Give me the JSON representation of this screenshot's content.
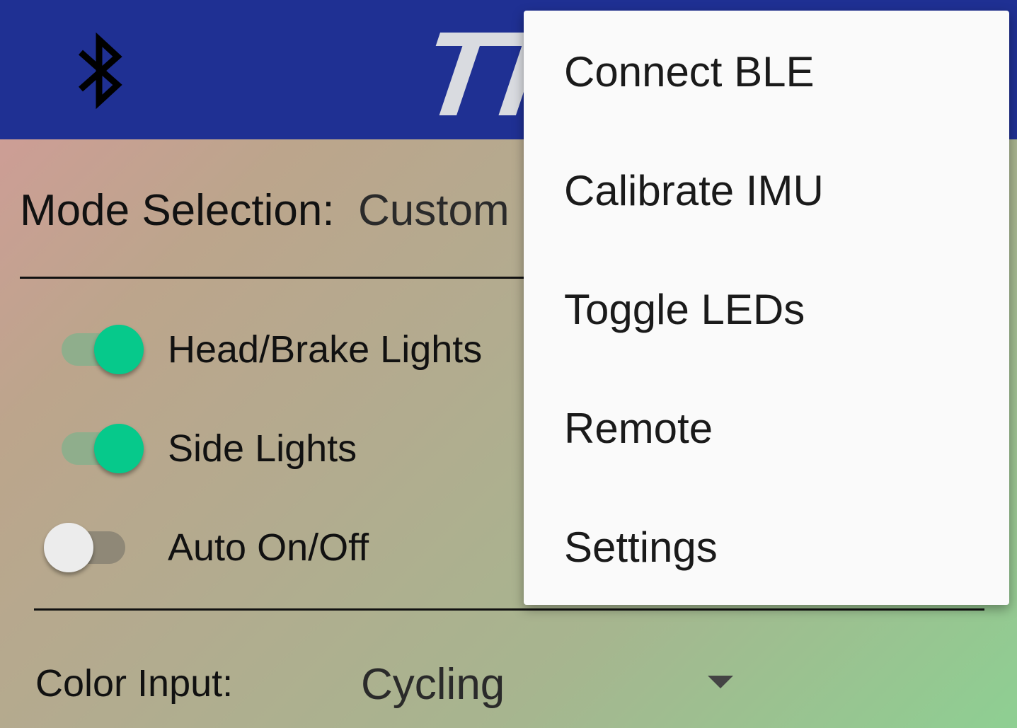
{
  "toolbar": {
    "bluetooth_icon": "bluetooth-icon",
    "logo_text": "TT",
    "background_color": "#1f3093"
  },
  "mode": {
    "label": "Mode Selection:",
    "value": "Custom"
  },
  "switches": [
    {
      "label": "Head/Brake Lights",
      "on": true
    },
    {
      "label": "Side Lights",
      "on": true
    },
    {
      "label": "Auto On/Off",
      "on": false
    }
  ],
  "switch_colors": {
    "on_thumb": "#06c98b",
    "on_track": "#8fae8c",
    "off_thumb": "#ececec",
    "off_track": "#8f8877"
  },
  "color_input": {
    "label": "Color Input:",
    "value": "Cycling",
    "arrow_icon": "dropdown-arrow-icon"
  },
  "overflow_menu": {
    "items": [
      {
        "label": "Connect BLE"
      },
      {
        "label": "Calibrate IMU"
      },
      {
        "label": "Toggle LEDs"
      },
      {
        "label": "Remote"
      },
      {
        "label": "Settings"
      }
    ]
  }
}
